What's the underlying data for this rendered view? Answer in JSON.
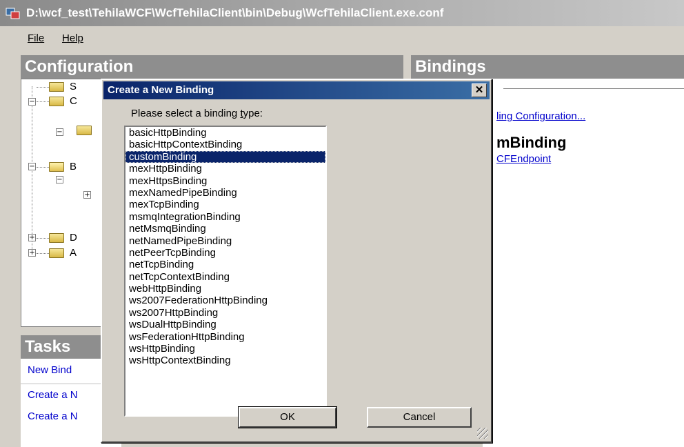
{
  "window": {
    "title": "D:\\wcf_test\\TehilaWCF\\WcfTehilaClient\\bin\\Debug\\WcfTehilaClient.exe.conf",
    "icon": "config-app-icon"
  },
  "menu": {
    "file": "File",
    "help": "Help"
  },
  "panels": {
    "configuration": "Configuration",
    "bindings": "Bindings",
    "tasks": "Tasks"
  },
  "tree": {
    "items": [
      "S",
      "C",
      "B",
      "D",
      "A"
    ]
  },
  "tasks": {
    "links": [
      "New Bind",
      "Create a N",
      "Create a N"
    ]
  },
  "right": {
    "link1": "ling Configuration...",
    "title": "mBinding",
    "link2": "CFEndpoint"
  },
  "dialog": {
    "title": "Create a New Binding",
    "close": "✕",
    "prompt_before": "Please select a binding ",
    "prompt_accel": "t",
    "prompt_after": "ype:",
    "selected": "customBinding",
    "bindings": [
      "basicHttpBinding",
      "basicHttpContextBinding",
      "customBinding",
      "mexHttpBinding",
      "mexHttpsBinding",
      "mexNamedPipeBinding",
      "mexTcpBinding",
      "msmqIntegrationBinding",
      "netMsmqBinding",
      "netNamedPipeBinding",
      "netPeerTcpBinding",
      "netTcpBinding",
      "netTcpContextBinding",
      "webHttpBinding",
      "ws2007FederationHttpBinding",
      "ws2007HttpBinding",
      "wsDualHttpBinding",
      "wsFederationHttpBinding",
      "wsHttpBinding",
      "wsHttpContextBinding"
    ],
    "ok": "OK",
    "cancel": "Cancel"
  },
  "colors": {
    "selection": "#0a246a",
    "link": "#0000cc",
    "panel_header": "#8e8e8e"
  }
}
